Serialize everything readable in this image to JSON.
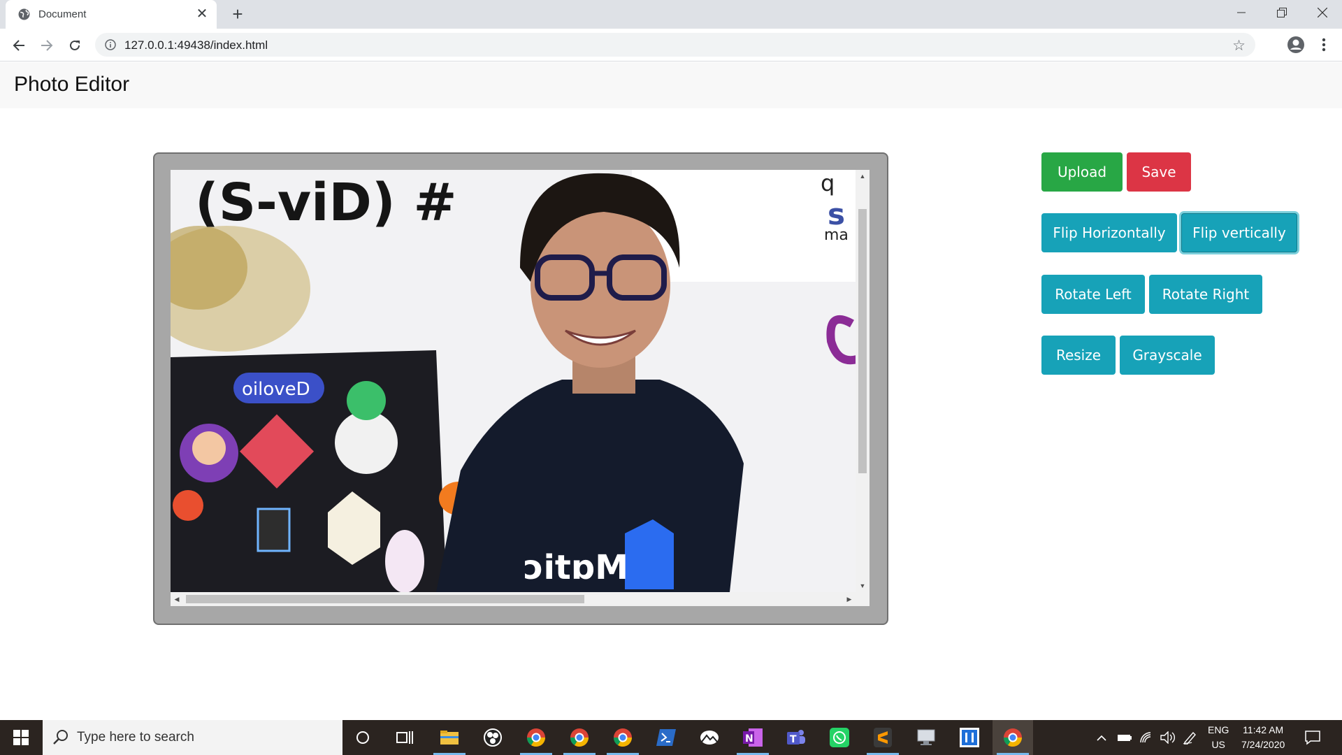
{
  "browser": {
    "tab_title": "Document",
    "url": "127.0.0.1:49438/index.html"
  },
  "app": {
    "title": "Photo Editor"
  },
  "buttons": {
    "upload": "Upload",
    "save": "Save",
    "flip_horizontal": "Flip Horizontally",
    "flip_vertical": "Flip vertically",
    "rotate_left": "Rotate Left",
    "rotate_right": "Rotate Right",
    "resize": "Resize",
    "grayscale": "Grayscale"
  },
  "canvas": {
    "mirrored_text": "# (Div-2)",
    "laptop_sticker": "Devfolio",
    "shirt_text": "Matic",
    "vertical_scroll_fraction": 0,
    "horizontal_scroll_fraction": 0
  },
  "taskbar": {
    "search_placeholder": "Type here to search",
    "language_top": "ENG",
    "language_bottom": "US",
    "time": "11:42 AM",
    "date": "7/24/2020"
  },
  "colors": {
    "success": "#28a745",
    "danger": "#dc3545",
    "info": "#17a2b8",
    "frame": "#a7a7a7",
    "taskbar": "#2b2420"
  }
}
